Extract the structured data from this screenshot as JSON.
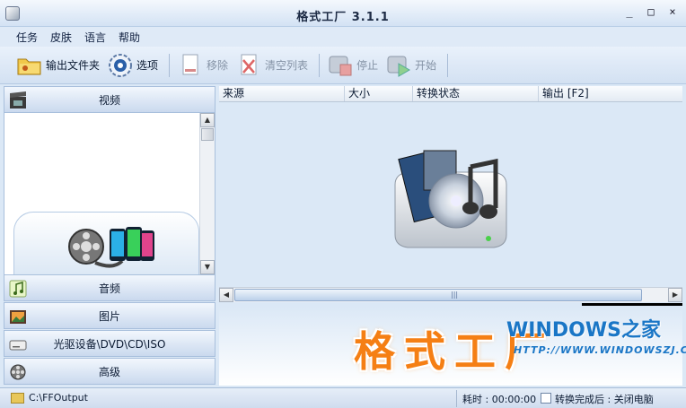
{
  "window": {
    "title": "格式工厂  3.1.1",
    "minimize": "_",
    "maximize": "□",
    "close": "×"
  },
  "menu": [
    "任务",
    "皮肤",
    "语言",
    "帮助"
  ],
  "toolbar": {
    "output_folder": "输出文件夹",
    "options": "选项",
    "remove": "移除",
    "clear_list": "清空列表",
    "stop": "停止",
    "start": "开始"
  },
  "categories": {
    "video": "视频",
    "audio": "音频",
    "image": "图片",
    "optical": "光驱设备\\DVD\\CD\\ISO",
    "advanced": "高级"
  },
  "columns": [
    "来源",
    "大小",
    "转换状态",
    "输出 [F2]"
  ],
  "watermark": {
    "brand": "格式工厂",
    "site_title": "WINDOWS之家",
    "site_url": "HTTP://WWW.WINDOWSZJ.COM/"
  },
  "status": {
    "output_path": "C:\\FFOutput",
    "elapsed": "耗时 : 00:00:00",
    "after_convert": "转换完成后 : 关闭电脑"
  },
  "colors": {
    "accent": "#1a76c6",
    "brand_orange": "#f57f14",
    "panel": "#dbe8f6"
  }
}
